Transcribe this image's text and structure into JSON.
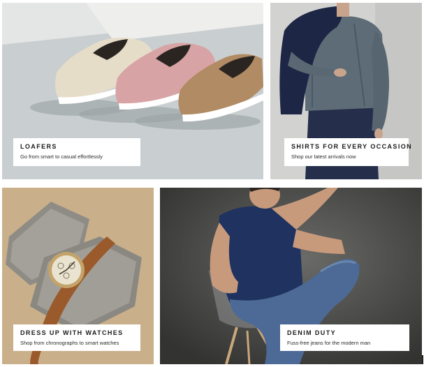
{
  "tiles": [
    {
      "title": "LOAFERS",
      "subtitle": "Go from smart to casual effortlessly"
    },
    {
      "title": "SHIRTS FOR EVERY OCCASION",
      "subtitle": "Shop our latest arrivals now"
    },
    {
      "title": "DRESS UP WITH WATCHES",
      "subtitle": "Shop from chronographs to smart watches"
    },
    {
      "title": "DENIM DUTY",
      "subtitle": "Fuss-free jeans for the modern man"
    }
  ],
  "colors": {
    "caption_bg": "#ffffff",
    "caption_text": "#1a1a1a",
    "loafers_bg": "#d9dcda",
    "shirts_bg": "#cfd0cf",
    "watches_bg": "#c7ad86",
    "denim_bg": "#4a4a48"
  }
}
